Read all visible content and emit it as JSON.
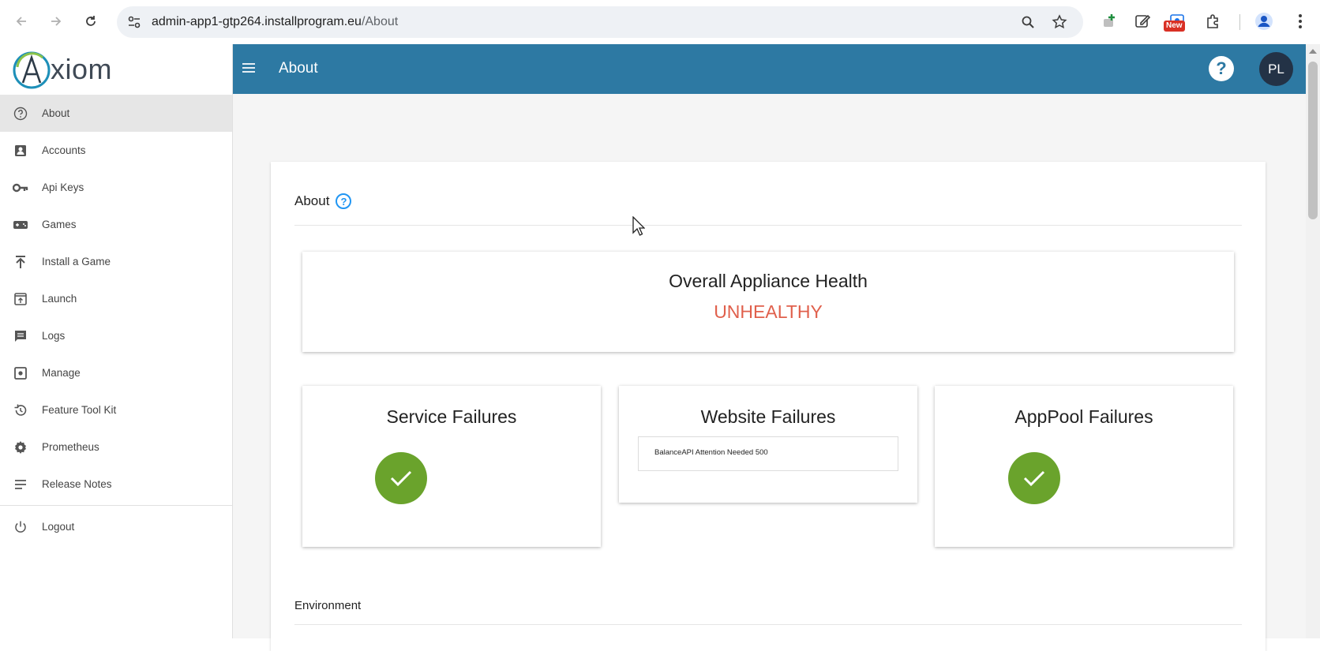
{
  "browser": {
    "url_host": "admin-app1-gtp264.installprogram.eu",
    "url_path": "/About",
    "extension_badge": "New"
  },
  "sidebar": {
    "logo_text": "xiom",
    "items": [
      {
        "label": "About",
        "icon": "help-circle-icon"
      },
      {
        "label": "Accounts",
        "icon": "account-box-icon"
      },
      {
        "label": "Api Keys",
        "icon": "key-icon"
      },
      {
        "label": "Games",
        "icon": "gamepad-icon"
      },
      {
        "label": "Install a Game",
        "icon": "upload-icon"
      },
      {
        "label": "Launch",
        "icon": "launch-window-icon"
      },
      {
        "label": "Logs",
        "icon": "message-icon"
      },
      {
        "label": "Manage",
        "icon": "manage-icon"
      },
      {
        "label": "Feature Tool Kit",
        "icon": "history-icon"
      },
      {
        "label": "Prometheus",
        "icon": "gear-icon"
      },
      {
        "label": "Release Notes",
        "icon": "notes-icon"
      }
    ],
    "logout_label": "Logout"
  },
  "appbar": {
    "title": "About",
    "help_symbol": "?",
    "avatar_initials": "PL"
  },
  "main": {
    "card_title": "About",
    "help_symbol": "?",
    "health": {
      "title": "Overall Appliance Health",
      "status": "UNHEALTHY",
      "status_color": "#e0604c"
    },
    "failures": {
      "service": {
        "title": "Service Failures",
        "state": "ok"
      },
      "website": {
        "title": "Website Failures",
        "entries": [
          "BalanceAPI Attention Needed 500"
        ]
      },
      "apppool": {
        "title": "AppPool Failures",
        "state": "ok"
      }
    },
    "environment_label": "Environment"
  },
  "colors": {
    "appbar": "#2d79a3",
    "ok_green": "#6aa32c",
    "avatar_bg": "#233246"
  }
}
